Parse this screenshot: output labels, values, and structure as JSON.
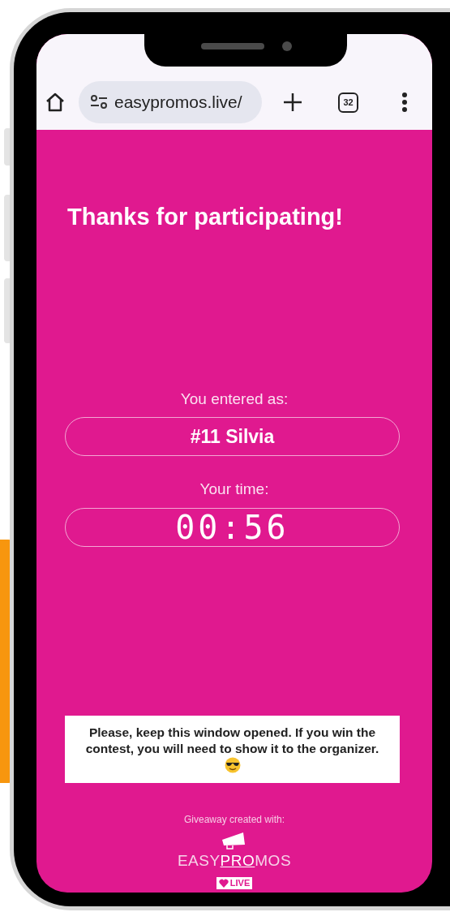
{
  "browser_bar": {
    "url": "easypromos.live/",
    "tab_count": "32"
  },
  "page": {
    "title": "Thanks for participating!",
    "entry_label": "You entered as:",
    "entry_value": "#11 Silvia",
    "time_label": "Your time:",
    "time_value": "00:56",
    "notice": "Please, keep this window opened. If you win the contest, you will need to show it to the organizer.",
    "credit": "Giveaway created with:",
    "logo_text": "EASY**PRO**MOS",
    "live_badge": "LIVE"
  }
}
